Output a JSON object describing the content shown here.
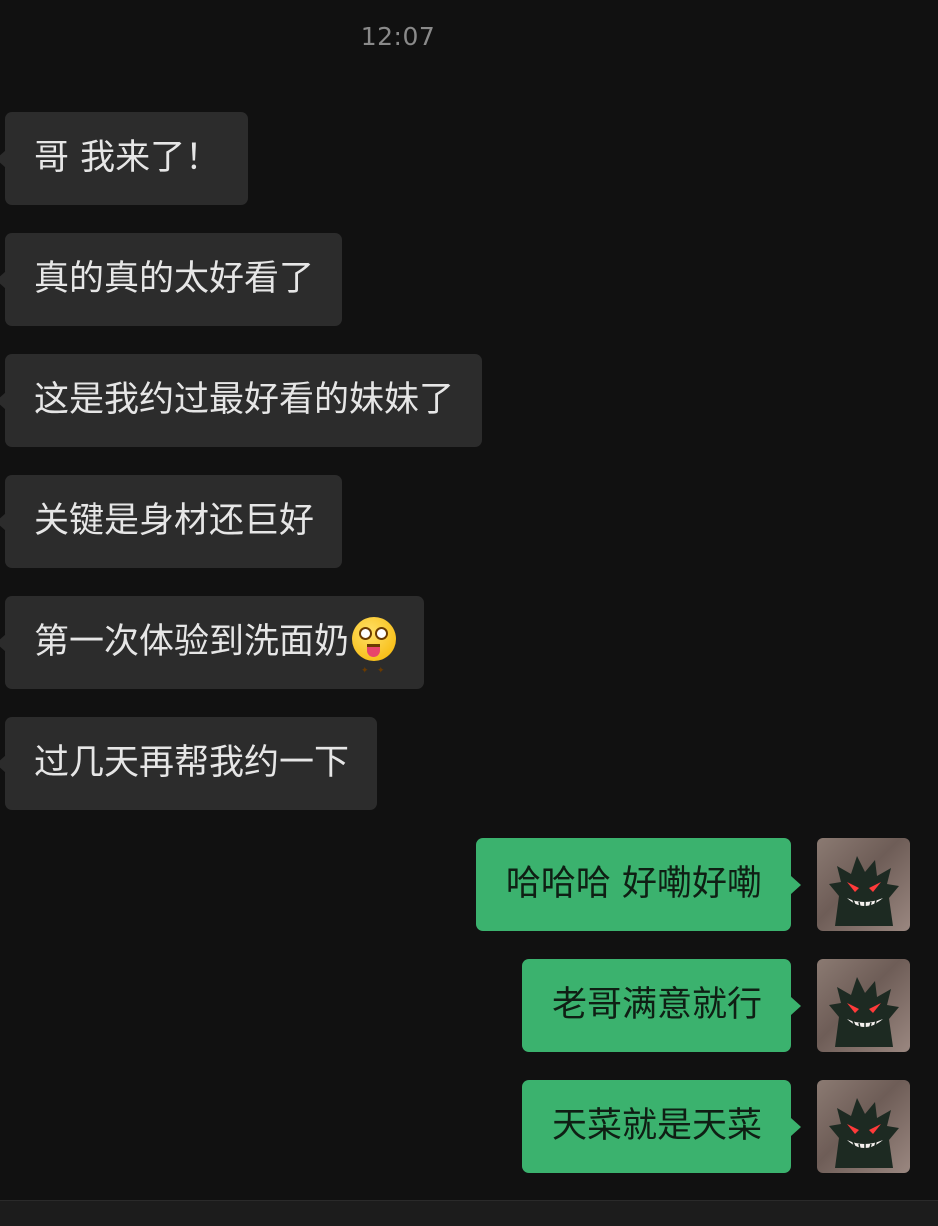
{
  "chat": {
    "timestamp": "12:07",
    "incoming_messages": [
      {
        "text": "哥 我来了！"
      },
      {
        "text": "真的真的太好看了"
      },
      {
        "text": "这是我约过最好看的妹妹了"
      },
      {
        "text": "关键是身材还巨好"
      },
      {
        "text": "第一次体验到洗面奶",
        "emoji": "star-struck-tongue-emoji"
      },
      {
        "text": "过几天再帮我约一下"
      }
    ],
    "outgoing_messages": [
      {
        "text": "哈哈哈 好嘞好嘞"
      },
      {
        "text": "老哥满意就行"
      },
      {
        "text": "天菜就是天菜"
      }
    ]
  },
  "colors": {
    "background": "#111111",
    "incoming_bubble": "#2c2c2c",
    "outgoing_bubble": "#3bb26e",
    "timestamp_text": "#8a8a8a"
  },
  "icons": {
    "avatar": "gengar-avatar-icon"
  }
}
